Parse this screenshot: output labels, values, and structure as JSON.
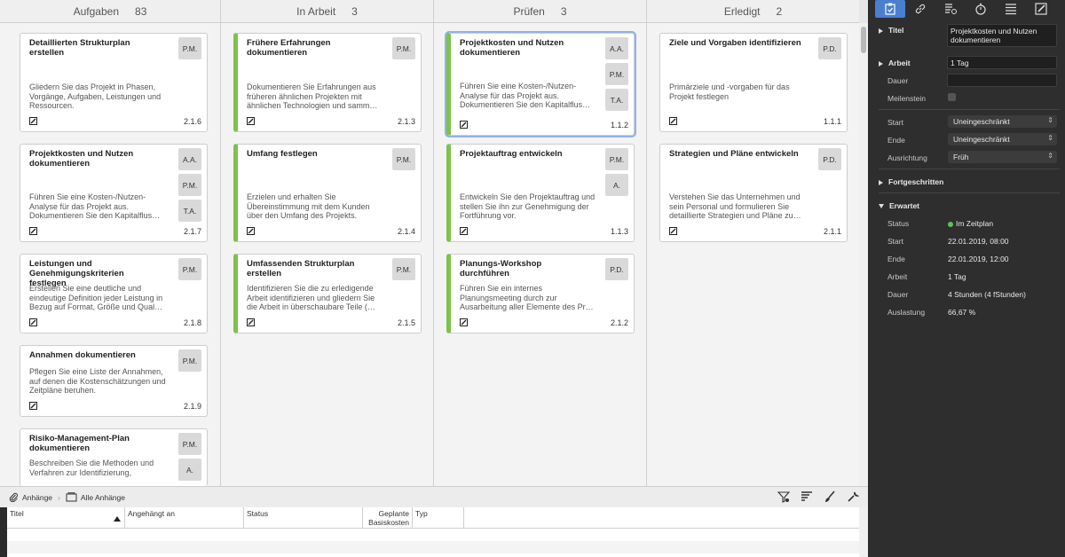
{
  "columns": [
    {
      "name": "Aufgaben",
      "count": "83"
    },
    {
      "name": "In Arbeit",
      "count": "3"
    },
    {
      "name": "Prüfen",
      "count": "3"
    },
    {
      "name": "Erledigt",
      "count": "2"
    }
  ],
  "cards": {
    "aufgaben": [
      {
        "title": "Detaillierten Strukturplan erstellen",
        "desc": "Gliedern Sie das Projekt in Phasen, Vorgänge, Aufgaben, Leistungen und Ressourcen.",
        "num": "2.1.6",
        "badges": [
          "P.M."
        ]
      },
      {
        "title": "Projektkosten und Nutzen dokumentieren",
        "desc": "Führen Sie eine Kosten-/Nutzen-Analyse für das Projekt aus. Dokumentieren Sie den Kapitalflus…",
        "num": "2.1.7",
        "badges": [
          "A.A.",
          "P.M.",
          "T.A."
        ]
      },
      {
        "title": "Leistungen und Genehmigungskriterien festlegen",
        "desc": "Erstellen Sie eine deutliche und eindeutige Definition jeder Leistung in Bezug auf Format, Größe und Qual…",
        "num": "2.1.8",
        "badges": [
          "P.M."
        ]
      },
      {
        "title": "Annahmen dokumentieren",
        "desc": "Pflegen Sie eine Liste der Annahmen, auf denen die Kostenschätzungen und Zeitpläne beruhen.",
        "num": "2.1.9",
        "badges": [
          "P.M."
        ]
      },
      {
        "title": "Risiko-Management-Plan dokumentieren",
        "desc": "Beschreiben Sie die Methoden und Verfahren zur Identifizierung,",
        "num": "",
        "badges": [
          "P.M.",
          "A."
        ]
      }
    ],
    "in_arbeit": [
      {
        "title": "Frühere Erfahrungen dokumentieren",
        "desc": "Dokumentieren Sie Erfahrungen aus früheren ähnlichen Projekten mit ähnlichen Technologien und samm…",
        "num": "2.1.3",
        "badges": [
          "P.M."
        ]
      },
      {
        "title": "Umfang festlegen",
        "desc": "Erzielen und erhalten Sie Übereinstimmung mit dem Kunden über den Umfang des Projekts.",
        "num": "2.1.4",
        "badges": [
          "P.M."
        ]
      },
      {
        "title": "Umfassenden Strukturplan erstellen",
        "desc": "Identifizieren Sie die zu erledigende Arbeit identifizieren und gliedern Sie die Arbeit in überschaubare Teile (…",
        "num": "2.1.5",
        "badges": [
          "P.M."
        ]
      }
    ],
    "pruefen": [
      {
        "title": "Projektkosten und Nutzen dokumentieren",
        "desc": "Führen Sie eine Kosten-/Nutzen-Analyse für das Projekt aus. Dokumentieren Sie den Kapitalflus…",
        "num": "1.1.2",
        "badges": [
          "A.A.",
          "P.M.",
          "T.A."
        ]
      },
      {
        "title": "Projektauftrag entwickeln",
        "desc": "Entwickeln Sie den Projektauftrag und stellen Sie ihn zur Genehmigung der Fortführung vor.",
        "num": "1.1.3",
        "badges": [
          "P.M.",
          "A."
        ]
      },
      {
        "title": "Planungs-Workshop durchführen",
        "desc": "Führen Sie ein internes Planungsmeeting durch zur Ausarbeitung aller Elemente des Pr…",
        "num": "2.1.2",
        "badges": [
          "P.D."
        ]
      }
    ],
    "erledigt": [
      {
        "title": "Ziele und Vorgaben identifizieren",
        "desc": "Primärziele und -vorgaben für das Projekt festlegen",
        "num": "1.1.1",
        "badges": [
          "P.D."
        ]
      },
      {
        "title": "Strategien und Pläne entwickeln",
        "desc": "Verstehen Sie das Unternehmen und sein Personal und formulieren Sie detaillierte Strategien und Pläne zu…",
        "num": "2.1.1",
        "badges": [
          "P.D."
        ]
      }
    ]
  },
  "attachments": {
    "crumb1": "Anhänge",
    "crumb2": "Alle Anhänge",
    "headers": [
      "Titel",
      "Angehängt an",
      "Status",
      "Geplante Basiskosten",
      "Typ"
    ]
  },
  "inspector": {
    "titel_label": "Titel",
    "titel_value": "Projektkosten und Nutzen dokumentieren",
    "arbeit_label": "Arbeit",
    "arbeit_value": "1 Tag",
    "dauer_label": "Dauer",
    "dauer_value": "",
    "meilenstein_label": "Meilenstein",
    "start_label": "Start",
    "start_value": "Uneingeschränkt",
    "ende_label": "Ende",
    "ende_value": "Uneingeschränkt",
    "ausrichtung_label": "Ausrichtung",
    "ausrichtung_value": "Früh",
    "fortgeschritten_label": "Fortgeschritten",
    "erwartet_label": "Erwartet",
    "status_label": "Status",
    "status_value": "Im Zeitplan",
    "e_start_label": "Start",
    "e_start_value": "22.01.2019, 08:00",
    "e_ende_label": "Ende",
    "e_ende_value": "22.01.2019, 12:00",
    "e_arbeit_label": "Arbeit",
    "e_arbeit_value": "1 Tag",
    "e_dauer_label": "Dauer",
    "e_dauer_value": "4 Stunden (4 fStunden)",
    "auslastung_label": "Auslastung",
    "auslastung_value": "66,67 %"
  },
  "colors": {
    "accent": "#4a7fd0",
    "green": "#7dc24b",
    "status_green": "#5bc25b"
  }
}
